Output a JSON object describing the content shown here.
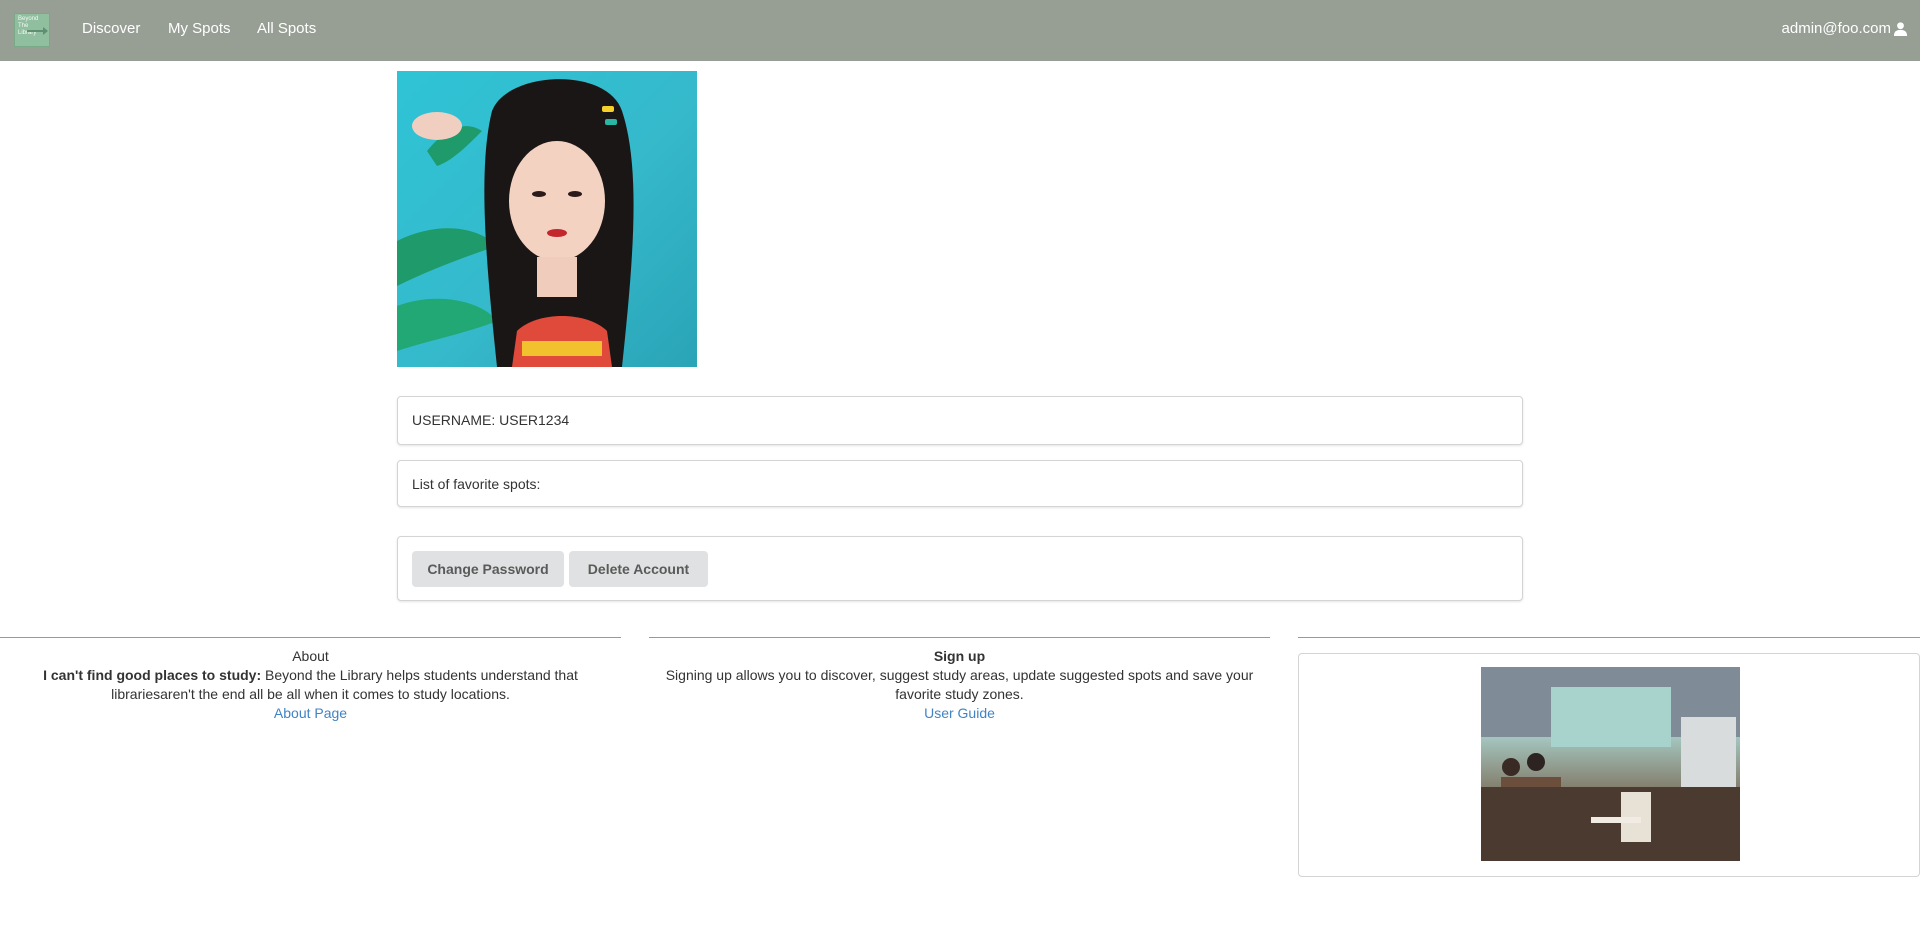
{
  "navbar": {
    "logo_text": "Beyond The Library",
    "links": [
      "Discover",
      "My Spots",
      "All Spots"
    ],
    "user_email": "admin@foo.com"
  },
  "profile": {
    "username_text": "USERNAME: USER1234",
    "favorites_label": "List of favorite spots:",
    "change_password_label": "Change Password",
    "delete_account_label": "Delete Account"
  },
  "footer": {
    "about": {
      "heading": "About",
      "bold_lead": "I can't find good places to study:",
      "body": " Beyond the Library helps students understand that librariesaren't the end all be all when it comes to study locations.",
      "link": "About Page"
    },
    "signup": {
      "heading": "Sign up",
      "body": "Signing up allows you to discover, suggest study areas, update suggested spots and save your favorite study zones.",
      "link": "User Guide"
    }
  },
  "colors": {
    "navbar_bg": "#979f95",
    "link": "#4183c4",
    "button_bg": "#e0e1e2"
  },
  "icons": [
    "user-icon"
  ]
}
